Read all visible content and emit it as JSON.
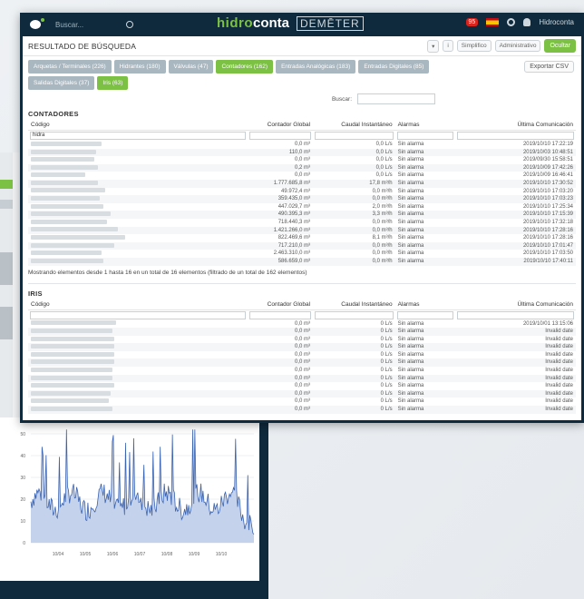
{
  "topbar": {
    "search_placeholder": "Buscar...",
    "brand_hidro": "hidro",
    "brand_conta": "conta",
    "brand_demeter": "DEMĒTER",
    "notifications": "95",
    "user": "Hidroconta"
  },
  "page": {
    "title": "RESULTADO DE BÚSQUEDA",
    "actions": [
      "Simplifico",
      "Administrativo"
    ],
    "action_primary": "Ocultar",
    "export": "Exportar CSV",
    "search_label": "Buscar:"
  },
  "tabs": [
    {
      "label": "Arquetas / Terminales (226)",
      "active": false
    },
    {
      "label": "Hidrantes (180)",
      "active": false
    },
    {
      "label": "Válvulas (47)",
      "active": false
    },
    {
      "label": "Contadores (162)",
      "active": true
    },
    {
      "label": "Entradas Analógicas (183)",
      "active": false
    },
    {
      "label": "Entradas Digitales (85)",
      "active": false
    },
    {
      "label": "Salidas Digitales (37)",
      "active": false
    },
    {
      "label": "Iris (63)",
      "active": true
    }
  ],
  "contadores": {
    "title": "CONTADORES",
    "columns": [
      "Código",
      "Contador Global",
      "Caudal Instantáneo",
      "Alarmas",
      "Última Comunicación"
    ],
    "filter_value": "hidra",
    "rows": [
      {
        "global": "0,0 m³",
        "caudal": "0,0 L/s",
        "alarma": "Sin alarma",
        "fecha": "2019/10/10 17:22:19"
      },
      {
        "global": "110,0 m³",
        "caudal": "0,0 L/s",
        "alarma": "Sin alarma",
        "fecha": "2019/10/03 10:48:51"
      },
      {
        "global": "0,0 m³",
        "caudal": "0,0 L/s",
        "alarma": "Sin alarma",
        "fecha": "2019/09/30 15:58:51"
      },
      {
        "global": "0,2 m³",
        "caudal": "0,0 L/s",
        "alarma": "Sin alarma",
        "fecha": "2019/10/09 17:42:26"
      },
      {
        "global": "0,0 m³",
        "caudal": "0,0 L/s",
        "alarma": "Sin alarma",
        "fecha": "2019/10/09 16:46:41"
      },
      {
        "global": "1.777.685,8 m³",
        "caudal": "17,8 m³/h",
        "alarma": "Sin alarma",
        "fecha": "2019/10/10 17:30:52"
      },
      {
        "global": "49.972,4 m³",
        "caudal": "0,0 m³/h",
        "alarma": "Sin alarma",
        "fecha": "2019/10/10 17:03:20"
      },
      {
        "global": "359.435,0 m³",
        "caudal": "0,0 m³/h",
        "alarma": "Sin alarma",
        "fecha": "2019/10/10 17:03:23"
      },
      {
        "global": "447.029,7 m³",
        "caudal": "2,0 m³/h",
        "alarma": "Sin alarma",
        "fecha": "2019/10/10 17:25:34"
      },
      {
        "global": "490.395,3 m³",
        "caudal": "3,3 m³/h",
        "alarma": "Sin alarma",
        "fecha": "2019/10/10 17:15:39"
      },
      {
        "global": "718.440,3 m³",
        "caudal": "0,0 m³/h",
        "alarma": "Sin alarma",
        "fecha": "2019/10/10 17:32:18"
      },
      {
        "global": "1.421.266,0 m³",
        "caudal": "0,0 m³/h",
        "alarma": "Sin alarma",
        "fecha": "2019/10/10 17:28:16"
      },
      {
        "global": "822.469,6 m³",
        "caudal": "8,1 m³/h",
        "alarma": "Sin alarma",
        "fecha": "2019/10/10 17:28:16"
      },
      {
        "global": "717.210,0 m³",
        "caudal": "0,0 m³/h",
        "alarma": "Sin alarma",
        "fecha": "2019/10/10 17:01:47"
      },
      {
        "global": "2.463.310,0 m³",
        "caudal": "0,0 m³/h",
        "alarma": "Sin alarma",
        "fecha": "2019/10/10 17:03:50"
      },
      {
        "global": "586.659,0 m³",
        "caudal": "0,0 m³/h",
        "alarma": "Sin alarma",
        "fecha": "2019/10/10 17:40:11"
      }
    ],
    "footer": "Mostrando elementos desde 1 hasta 16 en un total de 16 elementos (filtrado de un total de 162 elementos)"
  },
  "iris": {
    "title": "IRIS",
    "columns": [
      "Código",
      "Contador Global",
      "Caudal Instantáneo",
      "Alarmas",
      "Última Comunicación"
    ],
    "rows": [
      {
        "global": "0,0 m³",
        "caudal": "0 L/s",
        "alarma": "Sin alarma",
        "fecha": "2019/10/01 13:15:06"
      },
      {
        "global": "0,0 m³",
        "caudal": "0 L/s",
        "alarma": "Sin alarma",
        "fecha": "Invalid date"
      },
      {
        "global": "0,0 m³",
        "caudal": "0 L/s",
        "alarma": "Sin alarma",
        "fecha": "Invalid date"
      },
      {
        "global": "0,0 m³",
        "caudal": "0 L/s",
        "alarma": "Sin alarma",
        "fecha": "Invalid date"
      },
      {
        "global": "0,0 m³",
        "caudal": "0 L/s",
        "alarma": "Sin alarma",
        "fecha": "Invalid date"
      },
      {
        "global": "0,0 m³",
        "caudal": "0 L/s",
        "alarma": "Sin alarma",
        "fecha": "Invalid date"
      },
      {
        "global": "0,0 m³",
        "caudal": "0 L/s",
        "alarma": "Sin alarma",
        "fecha": "Invalid date"
      },
      {
        "global": "0,0 m³",
        "caudal": "0 L/s",
        "alarma": "Sin alarma",
        "fecha": "Invalid date"
      },
      {
        "global": "0,0 m³",
        "caudal": "0 L/s",
        "alarma": "Sin alarma",
        "fecha": "Invalid date"
      },
      {
        "global": "0,0 m³",
        "caudal": "0 L/s",
        "alarma": "Sin alarma",
        "fecha": "Invalid date"
      },
      {
        "global": "0,0 m³",
        "caudal": "0 L/s",
        "alarma": "Sin alarma",
        "fecha": "Invalid date"
      },
      {
        "global": "0,0 m³",
        "caudal": "0 L/s",
        "alarma": "Sin alarma",
        "fecha": "Invalid date"
      }
    ]
  },
  "background_chart": {
    "x_ticks": [
      "10/04",
      "10/05",
      "10/06",
      "10/07",
      "10/08",
      "10/09",
      "10/10"
    ],
    "y_ticks": [
      "0",
      "10",
      "20",
      "30",
      "40",
      "50"
    ],
    "line_color": "#3a63b0",
    "fill_color": "#c5d2ec"
  },
  "colors": {
    "accent": "#7cc143",
    "navy": "#0f2a3c",
    "tab": "#a9b7c0"
  }
}
